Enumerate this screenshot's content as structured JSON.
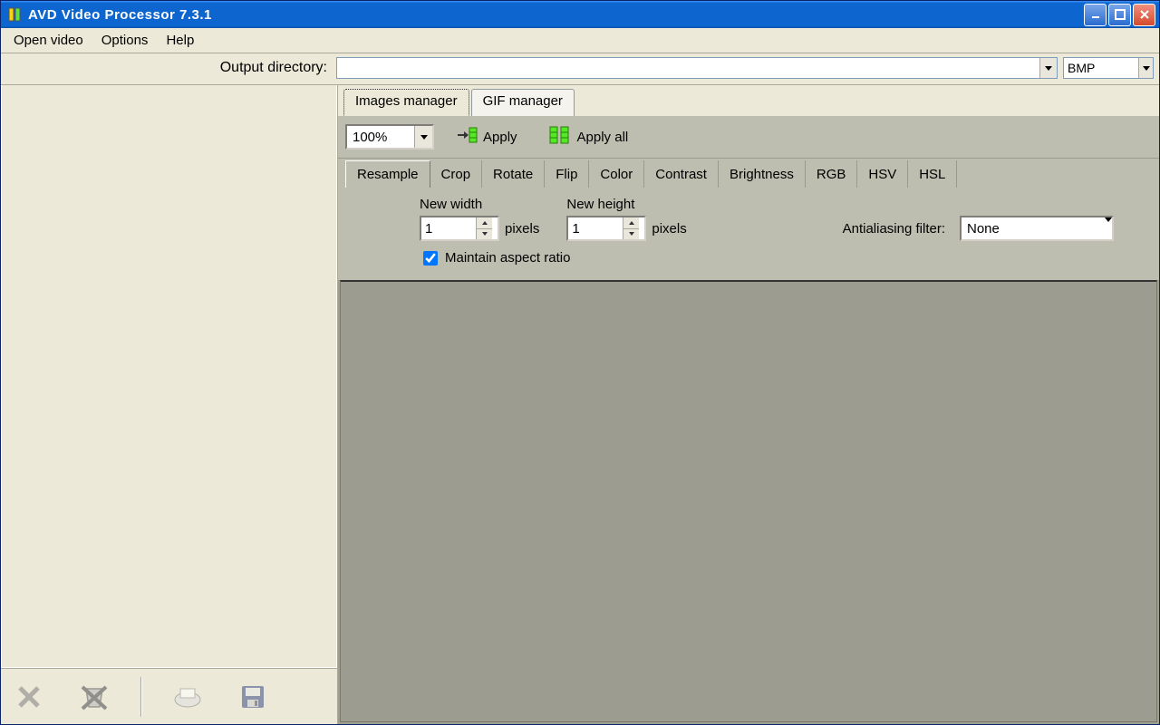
{
  "window": {
    "title": "AVD Video Processor 7.3.1"
  },
  "menu": {
    "open_video": "Open video",
    "options": "Options",
    "help": "Help"
  },
  "output": {
    "label": "Output directory:",
    "path": "",
    "format": "BMP"
  },
  "managers": {
    "images": "Images manager",
    "gif": "GIF manager"
  },
  "toolbar": {
    "zoom": "100%",
    "apply": "Apply",
    "apply_all": "Apply all"
  },
  "op_tabs": {
    "resample": "Resample",
    "crop": "Crop",
    "rotate": "Rotate",
    "flip": "Flip",
    "color": "Color",
    "contrast": "Contrast",
    "brightness": "Brightness",
    "rgb": "RGB",
    "hsv": "HSV",
    "hsl": "HSL"
  },
  "resample": {
    "new_width_label": "New width",
    "new_width_value": "1",
    "new_height_label": "New height",
    "new_height_value": "1",
    "pixels": "pixels",
    "maintain_ar": "Maintain aspect ratio",
    "aa_label": "Antialiasing filter:",
    "aa_value": "None"
  }
}
